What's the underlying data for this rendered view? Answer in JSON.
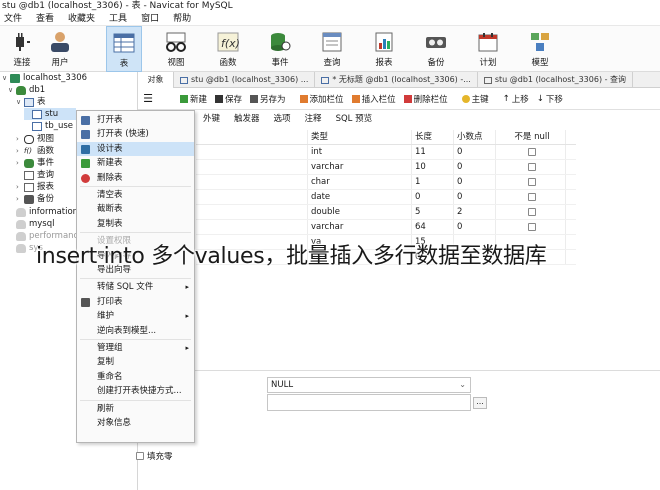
{
  "window": {
    "title": "stu @db1 (localhost_3306) - 表 - Navicat for MySQL"
  },
  "menu": [
    "文件",
    "查看",
    "收藏夹",
    "工具",
    "窗口",
    "帮助"
  ],
  "toolbar": [
    {
      "label": "连接",
      "icon": "plug-icon"
    },
    {
      "label": "用户",
      "icon": "user-icon"
    },
    {
      "label": "表",
      "icon": "table-icon",
      "selected": true
    },
    {
      "label": "视图",
      "icon": "view-glasses-icon"
    },
    {
      "label": "函数",
      "icon": "function-icon"
    },
    {
      "label": "事件",
      "icon": "event-icon"
    },
    {
      "label": "查询",
      "icon": "query-icon"
    },
    {
      "label": "报表",
      "icon": "report-icon"
    },
    {
      "label": "备份",
      "icon": "backup-icon"
    },
    {
      "label": "计划",
      "icon": "schedule-icon"
    },
    {
      "label": "模型",
      "icon": "model-icon"
    }
  ],
  "tree": {
    "connection": "localhost_3306",
    "db": "db1",
    "tables_node": "表",
    "tables": [
      "stu",
      "tb_use"
    ],
    "nodes": [
      "视图",
      "函数",
      "事件",
      "查询",
      "报表",
      "备份"
    ],
    "other_dbs": [
      "information",
      "mysql",
      "performance",
      "sys"
    ]
  },
  "tabs": [
    {
      "label": "对象",
      "active": true
    },
    {
      "label": "stu @db1 (localhost_3306) ..."
    },
    {
      "label": "* 无标题 @db1 (localhost_3306) -..."
    },
    {
      "label": "stu @db1 (localhost_3306) - 查询"
    }
  ],
  "subtoolbar": {
    "menu_glyph": "☰",
    "new": "新建",
    "save": "保存",
    "save_as": "另存为",
    "add_field": "添加栏位",
    "insert_field": "插入栏位",
    "delete_field": "删除栏位",
    "primary_key": "主键",
    "move_up": "上移",
    "move_down": "下移"
  },
  "design_tabs": [
    "外键",
    "触发器",
    "选项",
    "注释",
    "SQL 预览"
  ],
  "grid": {
    "headers": [
      "类型",
      "长度",
      "小数点",
      "不是 null"
    ],
    "rows": [
      {
        "type": "int",
        "length": "11",
        "decimals": "0"
      },
      {
        "type": "varchar",
        "length": "10",
        "decimals": "0"
      },
      {
        "type": "char",
        "length": "1",
        "decimals": "0"
      },
      {
        "type": "date",
        "length": "0",
        "decimals": "0"
      },
      {
        "type": "double",
        "length": "5",
        "decimals": "2"
      },
      {
        "type": "varchar",
        "length": "64",
        "decimals": "0"
      },
      {
        "type": "va",
        "length": "15",
        "decimals": ""
      },
      {
        "type": "va",
        "length": "0",
        "decimals": ""
      }
    ]
  },
  "context_menu": {
    "items": [
      {
        "label": "打开表",
        "icon": "open-table-icon"
      },
      {
        "label": "打开表 (快速)",
        "icon": "open-table-fast-icon"
      },
      {
        "label": "设计表",
        "icon": "design-table-icon",
        "highlight": true
      },
      {
        "label": "新建表",
        "icon": "new-table-icon"
      },
      {
        "label": "删除表",
        "icon": "delete-table-icon"
      },
      {
        "label": "清空表"
      },
      {
        "label": "截断表"
      },
      {
        "label": "复制表"
      },
      {
        "label": "设置权限",
        "dim": true
      },
      {
        "label": "导入向导"
      },
      {
        "label": "导出向导"
      },
      {
        "label": "转储 SQL 文件",
        "submenu": true
      },
      {
        "label": "打印表",
        "icon": "print-icon"
      },
      {
        "label": "维护",
        "submenu": true
      },
      {
        "label": "逆向表到模型..."
      },
      {
        "label": "管理组",
        "submenu": true
      },
      {
        "label": "复制"
      },
      {
        "label": "重命名"
      },
      {
        "label": "创建打开表快捷方式..."
      },
      {
        "label": "刷新"
      },
      {
        "label": "对象信息"
      }
    ]
  },
  "overlay_caption": "insert into 多个values，批量插入多行数据至数据库",
  "bottom": {
    "default_value": "NULL",
    "dots": "...",
    "fill_zero": "填充零"
  }
}
